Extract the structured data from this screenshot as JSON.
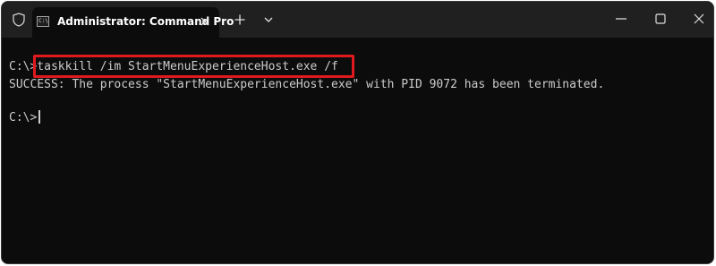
{
  "window": {
    "tab_title": "Administrator: Command Pro",
    "tab_icon_text": "C:\\",
    "icons": {
      "shield": "shield-icon",
      "tab": "command-prompt-icon",
      "tab_close": "close-icon",
      "new_tab": "plus-icon",
      "dropdown": "chevron-down-icon",
      "minimize": "minimize-icon",
      "maximize": "maximize-icon",
      "close": "close-icon"
    }
  },
  "terminal": {
    "line1": "C:\\>taskkill /im StartMenuExperienceHost.exe /f",
    "line2": "SUCCESS: The process \"StartMenuExperienceHost.exe\" with PID 9072 has been terminated.",
    "prompt": "C:\\>"
  },
  "colors": {
    "background": "#0c0c0c",
    "titlebar": "#202020",
    "text": "#cccccc",
    "highlight": "#e0191e"
  }
}
